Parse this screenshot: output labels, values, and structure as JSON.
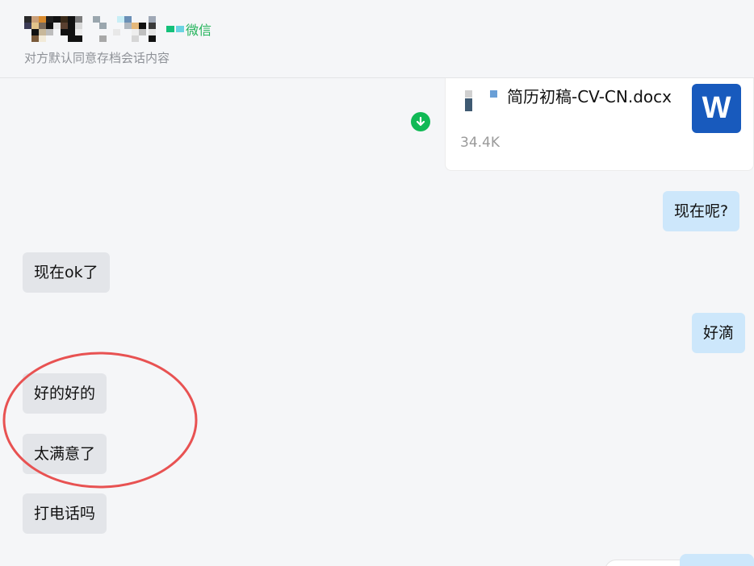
{
  "header": {
    "platform_label": "微信",
    "subtitle": "对方默认同意存档会话内容"
  },
  "file_message": {
    "file_name": "简历初稿-CV-CN.docx",
    "file_size": "34.4K",
    "file_type_icon": "word-doc-icon",
    "file_type_letter": "W",
    "action_icon": "download-icon"
  },
  "messages": [
    {
      "side": "right",
      "text": "现在呢?"
    },
    {
      "side": "left",
      "text": "现在ok了"
    },
    {
      "side": "right",
      "text": "好滴"
    },
    {
      "side": "left",
      "text": "好的好的"
    },
    {
      "side": "left",
      "text": "太满意了"
    },
    {
      "side": "left",
      "text": "打电话吗"
    }
  ],
  "colors": {
    "background": "#f5f6f8",
    "bubble_left": "#e3e5e9",
    "bubble_right": "#cde7fb",
    "annotation_circle": "#e85252",
    "platform_green": "#22b35a",
    "word_blue": "#185abd"
  }
}
